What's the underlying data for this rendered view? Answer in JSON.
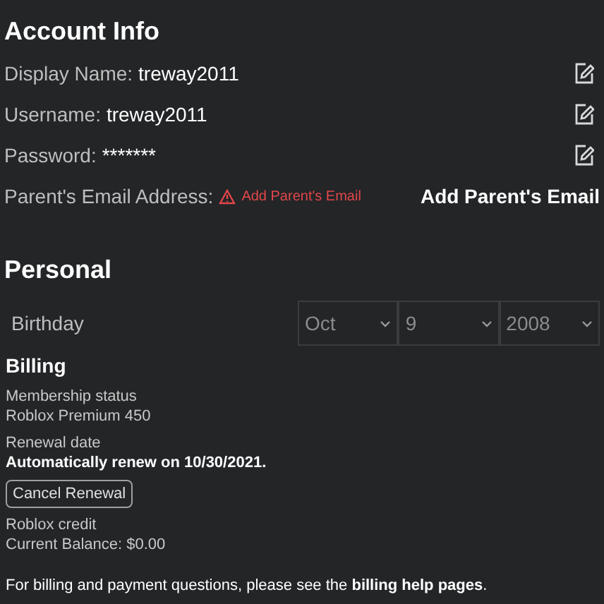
{
  "account": {
    "title": "Account Info",
    "rows": [
      {
        "label": "Display Name:",
        "value": "treway2011",
        "kind": "edit"
      },
      {
        "label": "Username:",
        "value": "treway2011",
        "kind": "edit"
      },
      {
        "label": "Password:",
        "value": "*******",
        "kind": "edit"
      },
      {
        "label": "Parent's Email Address:",
        "warning": "Add Parent's Email",
        "action": "Add Parent's Email",
        "kind": "action"
      }
    ]
  },
  "personal": {
    "title": "Personal",
    "birthday": {
      "label": "Birthday",
      "month": "Oct",
      "day": "9",
      "year": "2008"
    }
  },
  "billing": {
    "title": "Billing",
    "items": [
      {
        "label": "Membership status",
        "value": "Roblox Premium 450",
        "strong": false
      },
      {
        "label": "Renewal date",
        "value": "Automatically renew on 10/30/2021.",
        "strong": true
      }
    ],
    "button": "Cancel Renewal",
    "credit": {
      "label": "Roblox credit",
      "value": "Current Balance: $0.00"
    },
    "footer": {
      "text": "For billing and payment questions, please see the",
      "link": "billing help pages",
      "end": "."
    }
  }
}
